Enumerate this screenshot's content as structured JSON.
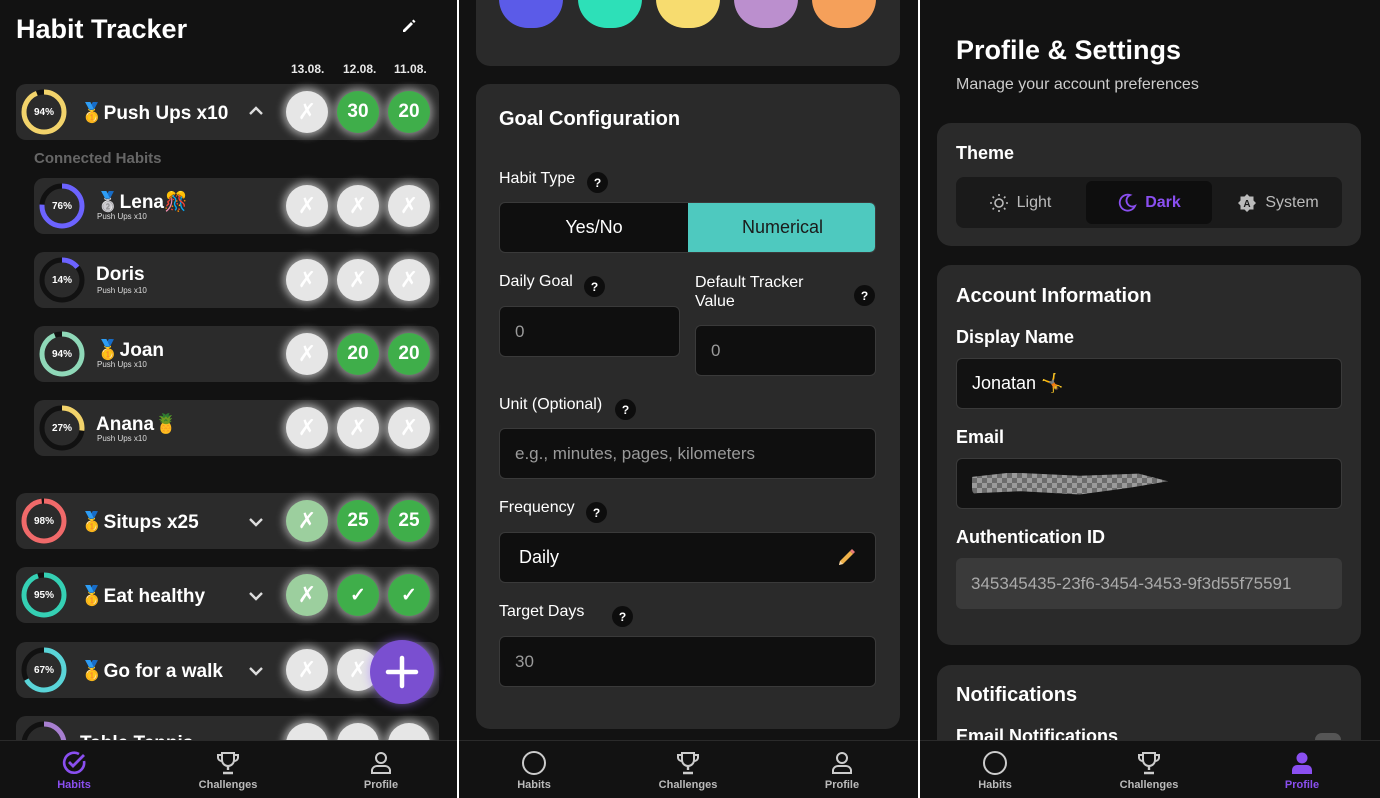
{
  "habits_panel": {
    "title": "Habit Tracker",
    "dates": [
      "13.08.",
      "12.08.",
      "11.08."
    ],
    "connected_label": "Connected Habits",
    "habits": [
      {
        "name": "🥇Push Ups x10",
        "pct": "94%",
        "progress": 0.94,
        "ring_color": "#f2d36b",
        "chevron": "^",
        "cells": [
          "✗",
          "30",
          "20"
        ],
        "cell_types": [
          "x",
          "g",
          "g"
        ]
      },
      {
        "name": "🥇Situps x25",
        "pct": "98%",
        "progress": 0.98,
        "ring_color": "#f06a6a",
        "chevron": "v",
        "cells": [
          "✗",
          "25",
          "25"
        ],
        "cell_types": [
          "xg",
          "g",
          "g"
        ]
      },
      {
        "name": "🥇Eat healthy",
        "pct": "95%",
        "progress": 0.95,
        "ring_color": "#35d0b4",
        "chevron": "v",
        "cells": [
          "✗",
          "✓",
          "✓"
        ],
        "cell_types": [
          "xg",
          "g",
          "g"
        ]
      },
      {
        "name": "🥇Go for a walk",
        "pct": "67%",
        "progress": 0.67,
        "ring_color": "#5ad4d8",
        "chevron": "v",
        "cells": [
          "✗",
          "✗",
          ""
        ],
        "cell_types": [
          "x",
          "x",
          "x"
        ]
      }
    ],
    "connected": [
      {
        "name": "🥈Lena🎊",
        "sub": "Push Ups x10",
        "pct": "76%",
        "progress": 0.76,
        "ring_color": "#6c63ff",
        "cells": [
          "✗",
          "✗",
          "✗"
        ]
      },
      {
        "name": "Doris",
        "sub": "Push Ups x10",
        "pct": "14%",
        "progress": 0.14,
        "ring_color": "#6c63ff",
        "cells": [
          "✗",
          "✗",
          "✗"
        ]
      },
      {
        "name": "🥇Joan",
        "sub": "Push Ups x10",
        "pct": "94%",
        "progress": 0.94,
        "ring_color": "#8fd8b8",
        "cells": [
          "✗",
          "20",
          "20"
        ]
      },
      {
        "name": "Anana🍍",
        "sub": "Push Ups x10",
        "pct": "27%",
        "progress": 0.27,
        "ring_color": "#f2d36b",
        "cells": [
          "✗",
          "✗",
          "✗"
        ]
      }
    ],
    "partial_row": {
      "name": "Table Tennis",
      "ring_color": "#a77fd0"
    }
  },
  "goal_panel": {
    "swatches": [
      "#5b5be8",
      "#2de0b8",
      "#f7dc6f",
      "#bb8fce",
      "#f5a05a"
    ],
    "title": "Goal Configuration",
    "habit_type_label": "Habit Type",
    "type_yes_no": "Yes/No",
    "type_numerical": "Numerical",
    "daily_goal_label": "Daily Goal",
    "daily_goal_value": "0",
    "default_tracker_label": "Default Tracker Value",
    "default_tracker_value": "0",
    "unit_label": "Unit (Optional)",
    "unit_placeholder": "e.g., minutes, pages, kilometers",
    "frequency_label": "Frequency",
    "frequency_value": "Daily",
    "target_days_label": "Target Days",
    "target_days_value": "30",
    "help": "?"
  },
  "profile_panel": {
    "title": "Profile & Settings",
    "subtitle": "Manage your account preferences",
    "theme_label": "Theme",
    "theme_options": [
      "Light",
      "Dark",
      "System"
    ],
    "account_title": "Account Information",
    "display_name_label": "Display Name",
    "display_name_value": "Jonatan 🤸",
    "email_label": "Email",
    "auth_label": "Authentication ID",
    "auth_value": "345345435-23f6-3454-3453-9f3d55f75591",
    "notifications_title": "Notifications",
    "email_notifications_label": "Email Notifications"
  },
  "nav": {
    "habits": "Habits",
    "challenges": "Challenges",
    "profile": "Profile"
  }
}
